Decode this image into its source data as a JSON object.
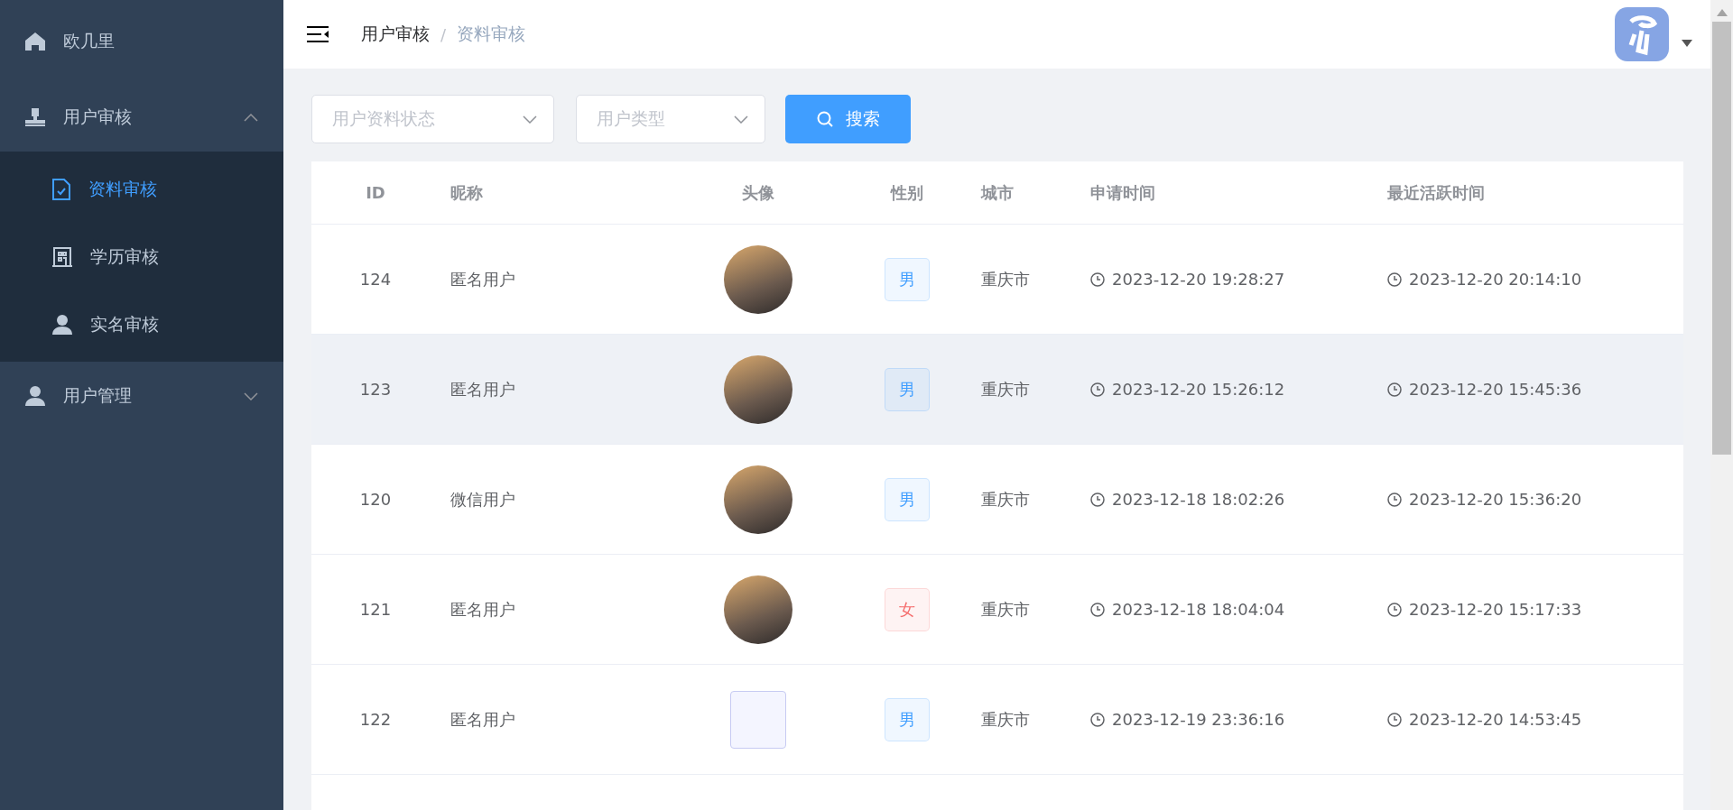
{
  "sidebar": {
    "items": [
      {
        "kind": "home",
        "label": "欧几里",
        "expanded": false,
        "selected": false
      },
      {
        "kind": "stamp",
        "label": "用户审核",
        "expanded": true,
        "children": [
          {
            "kind": "doc",
            "label": "资料审核",
            "selected": true
          },
          {
            "kind": "building",
            "label": "学历审核",
            "selected": false
          },
          {
            "kind": "person",
            "label": "实名审核",
            "selected": false
          }
        ]
      },
      {
        "kind": "person",
        "label": "用户管理",
        "expanded": false
      }
    ]
  },
  "header": {
    "breadcrumb": [
      "用户审核",
      "资料审核"
    ],
    "separator": "/"
  },
  "filters": {
    "selects": [
      {
        "placeholder": "用户资料状态"
      },
      {
        "placeholder": "用户类型"
      }
    ],
    "button": "搜索"
  },
  "table": {
    "columns": [
      "ID",
      "昵称",
      "头像",
      "性别",
      "城市",
      "申请时间",
      "最近活跃时间"
    ],
    "rows": [
      {
        "id": "124",
        "nickname": "匿名用户",
        "avatar": {
          "kind": "photo"
        },
        "gender": {
          "text": "男",
          "color": "#409eff"
        },
        "city": "重庆市",
        "applied": "2023-12-20 19:28:27",
        "active": "2023-12-20 20:14:10",
        "highlighted": false
      },
      {
        "id": "123",
        "nickname": "匿名用户",
        "avatar": {
          "kind": "photo"
        },
        "gender": {
          "text": "男",
          "color": "#409eff"
        },
        "city": "重庆市",
        "applied": "2023-12-20 15:26:12",
        "active": "2023-12-20 15:45:36",
        "highlighted": true
      },
      {
        "id": "120",
        "nickname": "微信用户",
        "avatar": {
          "kind": "photo"
        },
        "gender": {
          "text": "男",
          "color": "#409eff"
        },
        "city": "重庆市",
        "applied": "2023-12-18 18:02:26",
        "active": "2023-12-20 15:36:20",
        "highlighted": false
      },
      {
        "id": "121",
        "nickname": "匿名用户",
        "avatar": {
          "kind": "photo"
        },
        "gender": {
          "text": "女",
          "color": "#f56c6c"
        },
        "city": "重庆市",
        "applied": "2023-12-18 18:04:04",
        "active": "2023-12-20 15:17:33",
        "highlighted": false
      },
      {
        "id": "122",
        "nickname": "匿名用户",
        "avatar": {
          "kind": "screenshot"
        },
        "gender": {
          "text": "男",
          "color": "#409eff"
        },
        "city": "重庆市",
        "applied": "2023-12-19 23:36:16",
        "active": "2023-12-20 14:53:45",
        "highlighted": false
      }
    ]
  }
}
